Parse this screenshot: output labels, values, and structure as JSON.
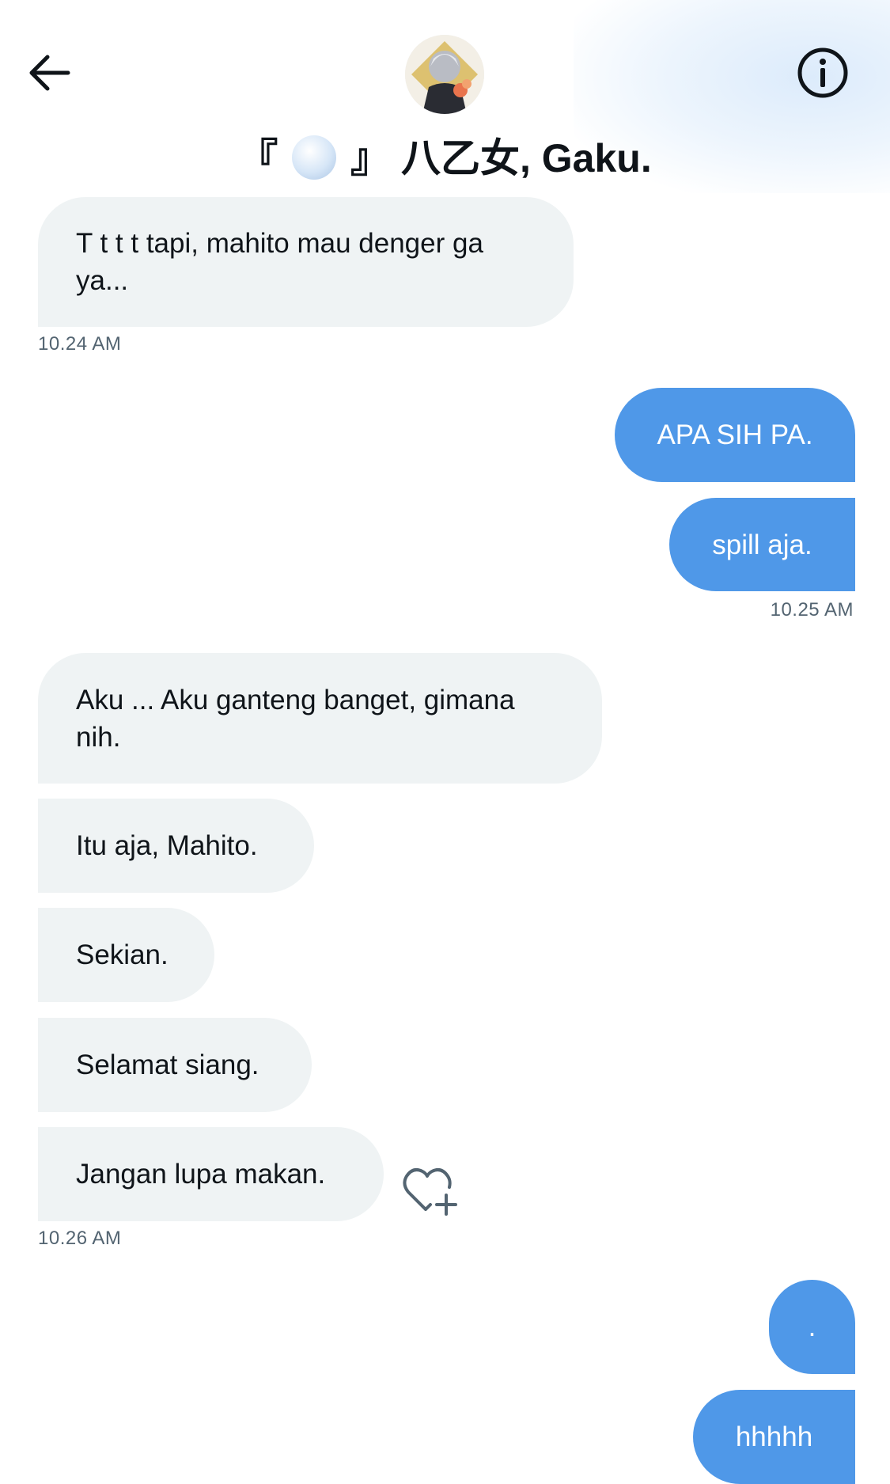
{
  "header": {
    "title_open": "『",
    "title_close": "』",
    "title_name": "八乙女, Gaku.",
    "icons": {
      "back": "arrow-left-icon",
      "info": "info-icon",
      "title_emoji": "fan-emoji"
    }
  },
  "messages": [
    {
      "text": "T t t t tapi, mahito mau denger ga ya...",
      "side": "incoming"
    },
    {
      "time": "10.24 AM"
    },
    {
      "text": "APA SIH PA.",
      "side": "outgoing"
    },
    {
      "text": "spill aja.",
      "side": "outgoing"
    },
    {
      "time": "10.25 AM"
    },
    {
      "text": "Aku ... Aku ganteng banget, gimana nih.",
      "side": "incoming"
    },
    {
      "text": "Itu aja, Mahito.",
      "side": "incoming"
    },
    {
      "text": "Sekian.",
      "side": "incoming"
    },
    {
      "text": "Selamat siang.",
      "side": "incoming"
    },
    {
      "text": "Jangan lupa makan.",
      "side": "incoming"
    },
    {
      "time": "10.26 AM"
    },
    {
      "text": ".",
      "side": "outgoing"
    },
    {
      "text": "hhhhh",
      "side": "outgoing"
    }
  ],
  "actions": {
    "like_icon": "heart-plus-icon"
  },
  "colors": {
    "outgoing_bubble": "#4f98e8",
    "incoming_bubble": "#eff3f4",
    "timestamp": "#536471"
  }
}
